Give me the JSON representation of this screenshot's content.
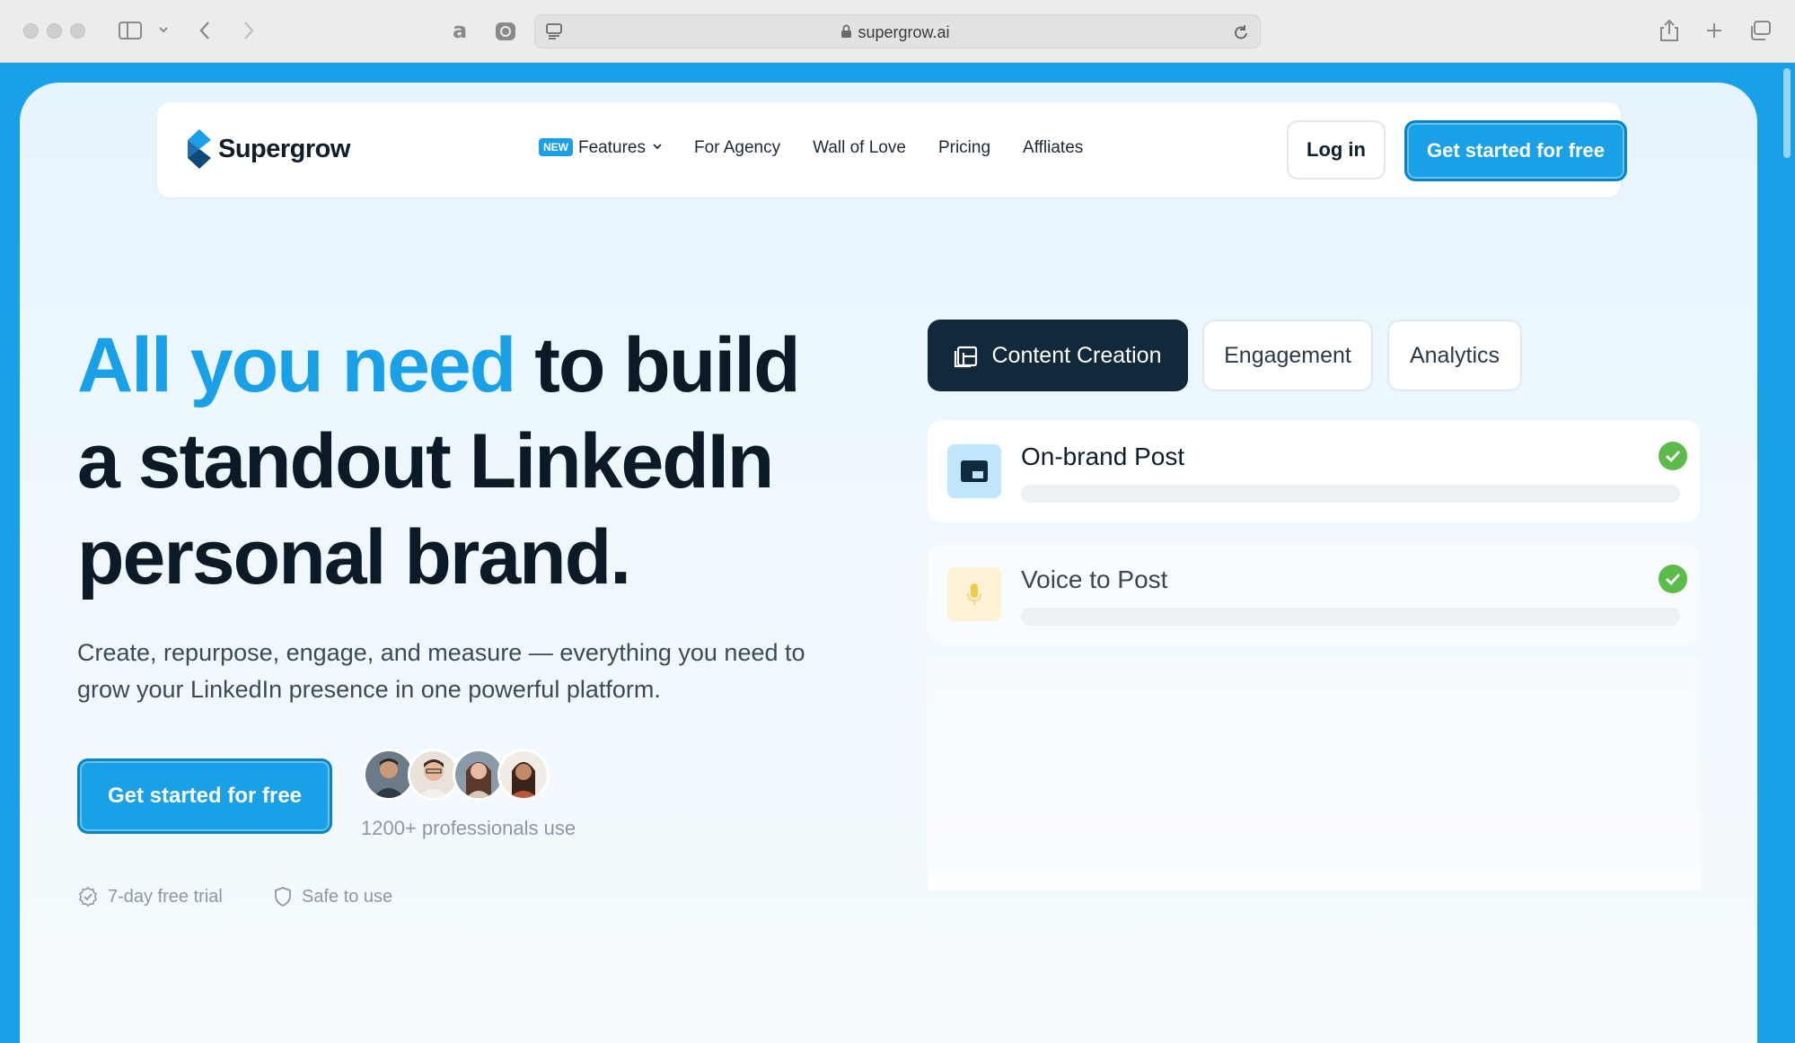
{
  "browser": {
    "url": "supergrow.ai"
  },
  "nav": {
    "logo_text": "Supergrow",
    "new_badge": "NEW",
    "links": [
      "Features",
      "For Agency",
      "Wall of Love",
      "Pricing",
      "Affliates"
    ],
    "login_label": "Log in",
    "cta_label": "Get started for free"
  },
  "hero": {
    "headline_accent": "All you need",
    "headline_rest_1": " to build",
    "headline_line_2": "a standout LinkedIn",
    "headline_line_3": "personal brand.",
    "subtitle": "Create, repurpose, engage, and measure — everything you need to grow your LinkedIn presence in one powerful platform.",
    "cta_label": "Get started for free",
    "social_proof": "1200+ professionals use",
    "trust_items": [
      "7-day free trial",
      "Safe to use"
    ]
  },
  "tabs": [
    "Content Creation",
    "Engagement",
    "Analytics"
  ],
  "features": [
    {
      "title": "On-brand Post",
      "status": "complete"
    },
    {
      "title": "Voice to Post",
      "status": "complete"
    }
  ],
  "colors": {
    "brand": "#1aa0e6",
    "dark": "#11293a",
    "success": "#5cbb4a"
  }
}
